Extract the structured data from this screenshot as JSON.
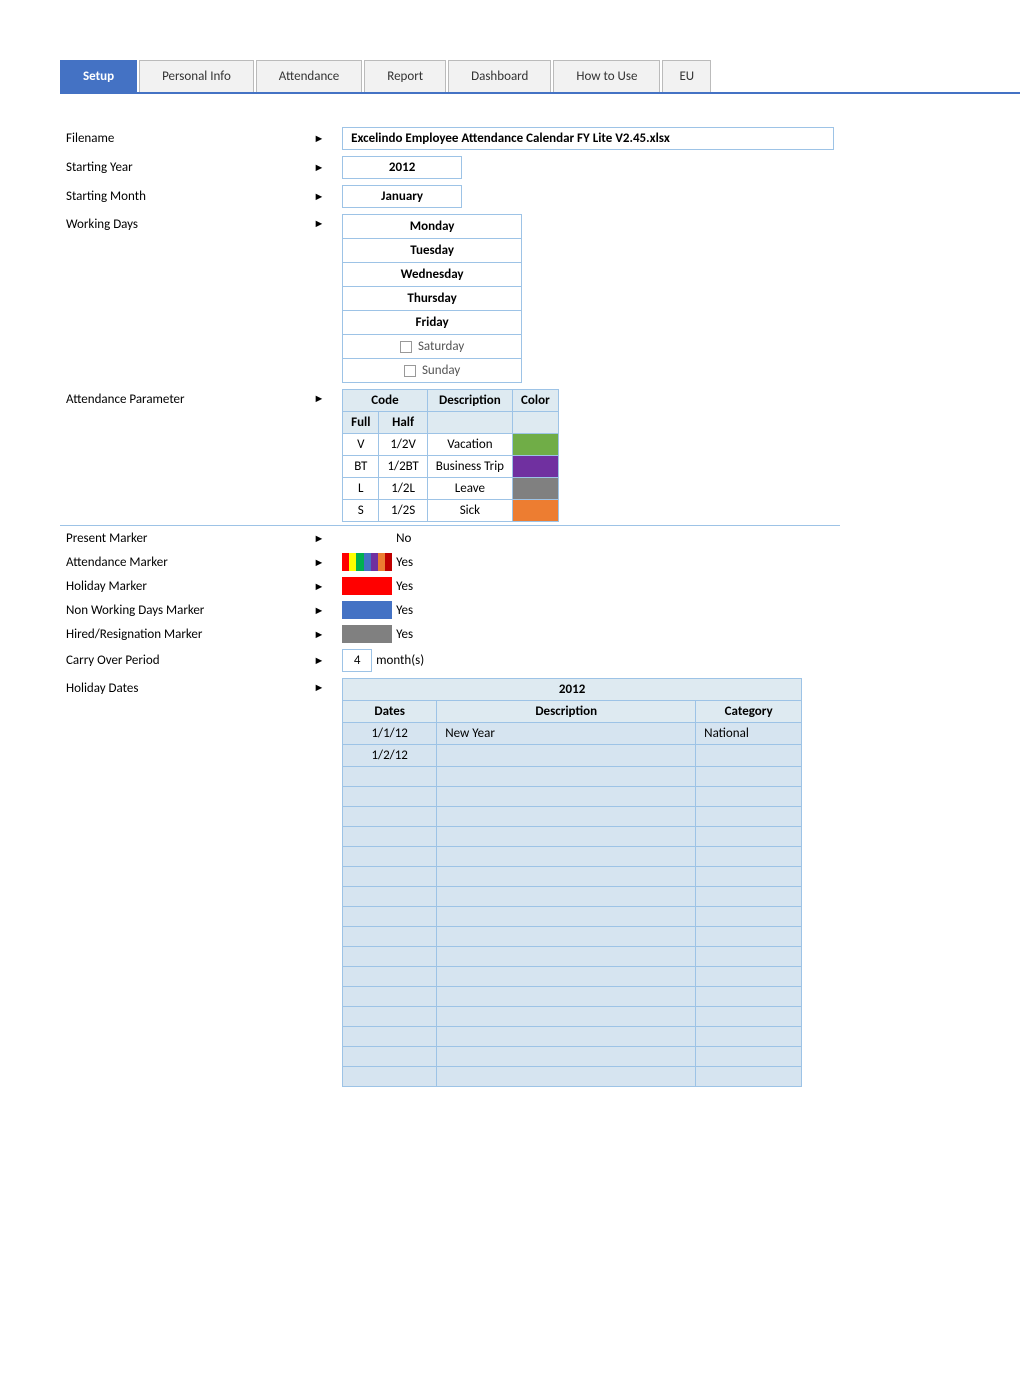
{
  "tabs": [
    {
      "label": "Setup",
      "active": true
    },
    {
      "label": "Personal Info",
      "active": false
    },
    {
      "label": "Attendance",
      "active": false
    },
    {
      "label": "Report",
      "active": false
    },
    {
      "label": "Dashboard",
      "active": false
    },
    {
      "label": "How to Use",
      "active": false
    },
    {
      "label": "EU",
      "active": false,
      "partial": true
    }
  ],
  "filename": {
    "label": "Filename",
    "value": "Excelindo Employee Attendance Calendar FY Lite V2.45.xlsx"
  },
  "starting_year": {
    "label": "Starting Year",
    "value": "2012"
  },
  "starting_month": {
    "label": "Starting Month",
    "value": "January"
  },
  "working_days": {
    "label": "Working Days",
    "days": [
      {
        "name": "Monday",
        "checked": true
      },
      {
        "name": "Tuesday",
        "checked": true
      },
      {
        "name": "Wednesday",
        "checked": true
      },
      {
        "name": "Thursday",
        "checked": true
      },
      {
        "name": "Friday",
        "checked": true
      },
      {
        "name": "Saturday",
        "checked": false
      },
      {
        "name": "Sunday",
        "checked": false
      }
    ]
  },
  "attendance_parameter": {
    "label": "Attendance Parameter",
    "headers": [
      "Full",
      "Half",
      "Description",
      "Color"
    ],
    "rows": [
      {
        "full": "V",
        "half": "1/2V",
        "description": "Vacation",
        "color": "green"
      },
      {
        "full": "BT",
        "half": "1/2BT",
        "description": "Business Trip",
        "color": "purple"
      },
      {
        "full": "L",
        "half": "1/2L",
        "description": "Leave",
        "color": "gray"
      },
      {
        "full": "S",
        "half": "1/2S",
        "description": "Sick",
        "color": "orange"
      }
    ]
  },
  "present_marker": {
    "label": "Present Marker",
    "value": "No"
  },
  "attendance_marker": {
    "label": "Attendance Marker",
    "value": "Yes"
  },
  "holiday_marker": {
    "label": "Holiday Marker",
    "value": "Yes"
  },
  "non_working_days_marker": {
    "label": "Non Working Days Marker",
    "value": "Yes"
  },
  "hired_resignation_marker": {
    "label": "Hired/Resignation Marker",
    "value": "Yes"
  },
  "carry_over": {
    "label": "Carry Over Period",
    "number": "4",
    "unit": "month(s)"
  },
  "holiday_dates": {
    "label": "Holiday Dates",
    "year": "2012",
    "headers": [
      "Dates",
      "Description",
      "Category"
    ],
    "rows": [
      {
        "date": "1/1/12",
        "description": "New Year",
        "category": "National"
      },
      {
        "date": "1/2/12",
        "description": "",
        "category": ""
      },
      {
        "date": "",
        "description": "",
        "category": ""
      },
      {
        "date": "",
        "description": "",
        "category": ""
      },
      {
        "date": "",
        "description": "",
        "category": ""
      },
      {
        "date": "",
        "description": "",
        "category": ""
      },
      {
        "date": "",
        "description": "",
        "category": ""
      },
      {
        "date": "",
        "description": "",
        "category": ""
      },
      {
        "date": "",
        "description": "",
        "category": ""
      },
      {
        "date": "",
        "description": "",
        "category": ""
      },
      {
        "date": "",
        "description": "",
        "category": ""
      },
      {
        "date": "",
        "description": "",
        "category": ""
      },
      {
        "date": "",
        "description": "",
        "category": ""
      },
      {
        "date": "",
        "description": "",
        "category": ""
      },
      {
        "date": "",
        "description": "",
        "category": ""
      },
      {
        "date": "",
        "description": "",
        "category": ""
      },
      {
        "date": "",
        "description": "",
        "category": ""
      },
      {
        "date": "",
        "description": "",
        "category": ""
      }
    ]
  },
  "code_label": "Code",
  "description_label": "Description",
  "color_label": "Color"
}
